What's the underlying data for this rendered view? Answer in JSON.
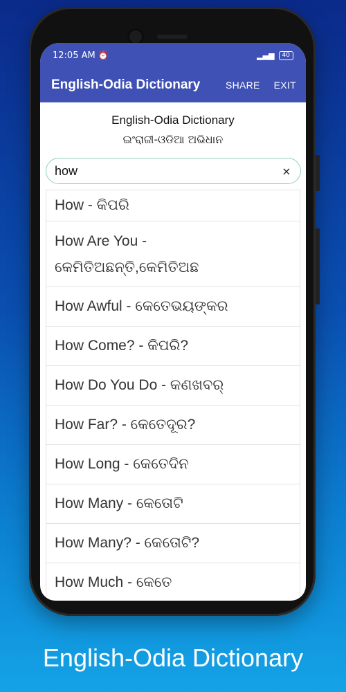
{
  "status_bar": {
    "time": "12:05 AM",
    "alarm_icon": "alarm-icon",
    "signal": "…▐▐",
    "battery": "40"
  },
  "app_bar": {
    "title": "English-Odia Dictionary",
    "share": "SHARE",
    "exit": "EXIT"
  },
  "header": {
    "title_en": "English-Odia Dictionary",
    "title_or": "ଇଂରାଜୀ-ଓଡିଆ ଅଭିଧାନ"
  },
  "search": {
    "value": "how",
    "clear": "×"
  },
  "results": [
    "How - କିପରି",
    "How Are You - କେମିତିଅଛନ୍ତି,କେମିତିଅଛ",
    "How Awful - କେତେଭୟଙ୍କର",
    "How Come? - କିପରି?",
    "How Do You Do - କଣଖବର୍",
    "How Far? - କେତେଦୂର?",
    "How Long - କେତେଦିନ",
    "How Many - କେତୋଟି",
    "How Many? - କେତୋଟି?",
    "How Much - କେତେ"
  ],
  "caption": "English-Odia Dictionary"
}
